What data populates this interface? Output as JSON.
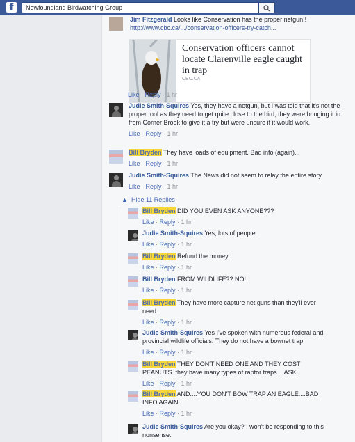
{
  "topbar": {
    "logo": "f",
    "search_value": "Newfoundland Birdwatching Group"
  },
  "top_comment": {
    "author": "Jim Fitzgerald",
    "text": "Looks like Conservation has the proper netgun!!",
    "url": "http://www.cbc.ca/.../conservation-officers-try-catch...",
    "preview_title": "Conservation officers cannot locate Clarenville eagle caught in trap",
    "preview_source": "CBC.CA",
    "actions": [
      "Like",
      "Reply",
      "1 hr"
    ]
  },
  "comments": [
    {
      "author": "Judie Smith-Squires",
      "redacted": false,
      "avatar": "dark",
      "text": "Yes, they have a netgun, but I was told that it's not the proper tool as they need to get quite close to the bird, they were bringing it in from Corner Brook to give it a try but were unsure if it would work.",
      "actions": [
        "Like",
        "Reply",
        "1 hr"
      ]
    },
    {
      "author": "Bill Bryden",
      "redacted": true,
      "avatar": "flag",
      "text": "They have loads of equipment. Bad info (again)...",
      "actions": [
        "Like",
        "Reply",
        "1 hr"
      ]
    },
    {
      "author": "Judie Smith-Squires",
      "redacted": false,
      "avatar": "dark",
      "text": "The News did not seem to relay the entire story.",
      "actions": [
        "Like",
        "Reply",
        "1 hr"
      ]
    }
  ],
  "hide_replies": "Hide 11 Replies",
  "replies": [
    {
      "author": "Bill Bryden",
      "redacted": true,
      "avatar": "flag",
      "text": "DID YOU EVEN ASK ANYONE???",
      "actions": [
        "Like",
        "Reply",
        "1 hr"
      ]
    },
    {
      "author": "Judie Smith-Squires",
      "redacted": false,
      "avatar": "dark",
      "text": "Yes, lots of people.",
      "actions": [
        "Like",
        "Reply",
        "1 hr"
      ]
    },
    {
      "author": "Bill Bryden",
      "redacted": true,
      "avatar": "flag",
      "text": "Refund the money...",
      "actions": [
        "Like",
        "Reply",
        "1 hr"
      ]
    },
    {
      "author": "Bill Bryden",
      "redacted": false,
      "avatar": "flag",
      "text": "FROM WILDLIFE?? NO!",
      "actions": [
        "Like",
        "Reply",
        "1 hr"
      ]
    },
    {
      "author": "Bill Bryden",
      "redacted": true,
      "avatar": "flag",
      "text": "They have more capture net guns than they'll ever need...",
      "actions": [
        "Like",
        "Reply",
        "1 hr"
      ]
    },
    {
      "author": "Judie Smith-Squires",
      "redacted": false,
      "avatar": "dark",
      "text": "Yes I've spoken with numerous federal and provincial wildlife officials. They do not have a bownet trap.",
      "actions": [
        "Like",
        "Reply",
        "1 hr"
      ]
    },
    {
      "author": "Bill Bryden",
      "redacted": true,
      "avatar": "flag",
      "text": "THEY DON'T NEED ONE AND THEY COST PEANUTS..they have many types of raptor traps....ASK",
      "actions": [
        "Like",
        "Reply",
        "1 hr"
      ]
    },
    {
      "author": "Bill Bryden",
      "redacted": true,
      "avatar": "flag",
      "text": "AND....YOU DON'T BOW TRAP AN EAGLE....BAD INFO AGAIN...",
      "actions": [
        "Like",
        "Reply",
        "1 hr"
      ]
    },
    {
      "author": "Judie Smith-Squires",
      "redacted": false,
      "avatar": "dark",
      "text": "Are you okay? I won't be responding to this nonsense.",
      "actions": []
    }
  ]
}
